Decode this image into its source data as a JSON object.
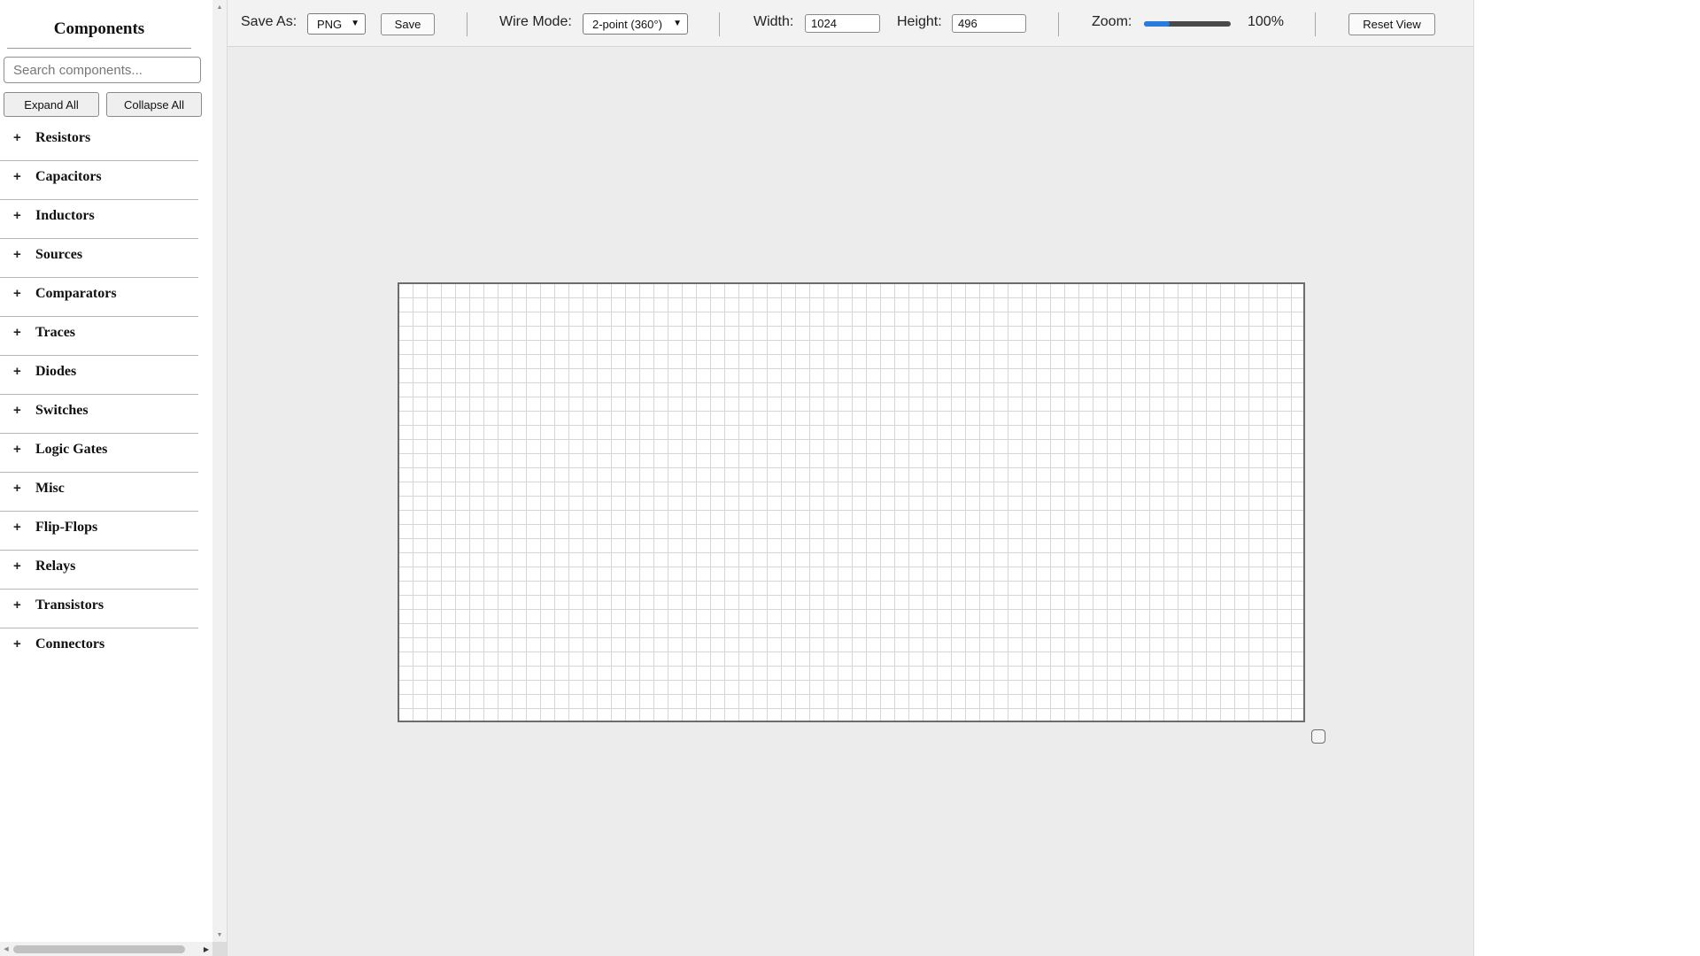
{
  "sidebar": {
    "title": "Components",
    "search_placeholder": "Search components...",
    "search_value": "",
    "expand_all_label": "Expand All",
    "collapse_all_label": "Collapse All",
    "expand_symbol": "+",
    "categories": [
      {
        "label": "Resistors"
      },
      {
        "label": "Capacitors"
      },
      {
        "label": "Inductors"
      },
      {
        "label": "Sources"
      },
      {
        "label": "Comparators"
      },
      {
        "label": "Traces"
      },
      {
        "label": "Diodes"
      },
      {
        "label": "Switches"
      },
      {
        "label": "Logic Gates"
      },
      {
        "label": "Misc"
      },
      {
        "label": "Flip-Flops"
      },
      {
        "label": "Relays"
      },
      {
        "label": "Transistors"
      },
      {
        "label": "Connectors"
      }
    ]
  },
  "toolbar": {
    "save_as_label": "Save As:",
    "save_format": "PNG",
    "save_label": "Save",
    "wire_mode_label": "Wire Mode:",
    "wire_mode": "2-point (360°)",
    "width_label": "Width:",
    "width_value": "1024",
    "height_label": "Height:",
    "height_value": "496",
    "zoom_label": "Zoom:",
    "zoom_value": "100%",
    "zoom_slider_fraction": 0.3,
    "reset_view_label": "Reset View"
  },
  "colors": {
    "accent": "#2a7be0",
    "workspace_bg": "#ececec",
    "toolbar_bg": "#f2f2f2",
    "grid_line": "#d6d6d6",
    "canvas_border": "#6c6c6c"
  },
  "icons": {
    "dropdown": "chevron-down-icon",
    "scroll_up": "triangle-up-icon",
    "scroll_down": "triangle-down-icon",
    "scroll_left": "triangle-left-icon",
    "scroll_right": "triangle-right-icon",
    "resize": "resize-handle-icon"
  }
}
